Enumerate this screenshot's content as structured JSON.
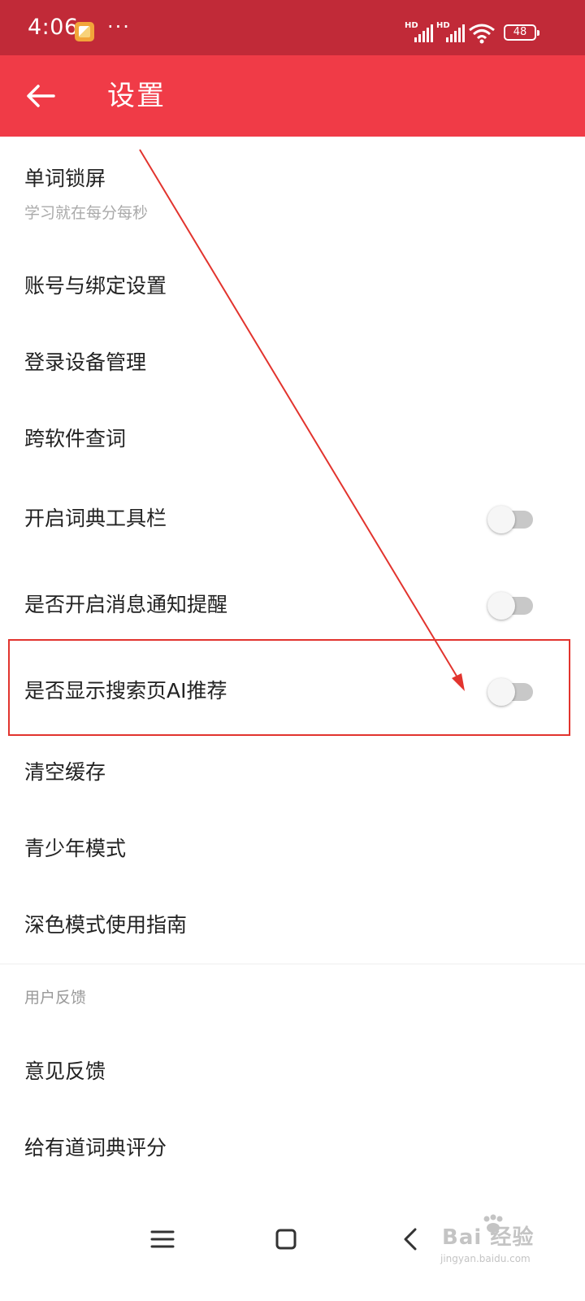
{
  "status_bar": {
    "time": "4:06",
    "more": "···",
    "signal1_label": "HD",
    "signal2_label": "HD",
    "battery": "48"
  },
  "app_bar": {
    "title": "设置"
  },
  "settings": {
    "items": [
      {
        "label": "单词锁屏",
        "subtitle": "学习就在每分每秒"
      },
      {
        "label": "账号与绑定设置"
      },
      {
        "label": "登录设备管理"
      },
      {
        "label": "跨软件查词"
      },
      {
        "label": "开启词典工具栏",
        "toggle": "off"
      },
      {
        "label": "是否开启消息通知提醒",
        "toggle": "off"
      },
      {
        "label": "是否显示搜索页AI推荐",
        "toggle": "off"
      },
      {
        "label": "清空缓存"
      },
      {
        "label": "青少年模式"
      },
      {
        "label": "深色模式使用指南"
      }
    ]
  },
  "feedback_section": {
    "header": "用户反馈",
    "items": [
      {
        "label": "意见反馈"
      },
      {
        "label": "给有道词典评分"
      }
    ]
  },
  "watermark": {
    "logo": "Bai  经验",
    "url": "jingyan.baidu.com"
  },
  "colors": {
    "status_bar": "#c12a38",
    "app_bar": "#f03b47",
    "annotation_red": "#e2342e",
    "toggle_off_track": "#c8c8c8"
  }
}
